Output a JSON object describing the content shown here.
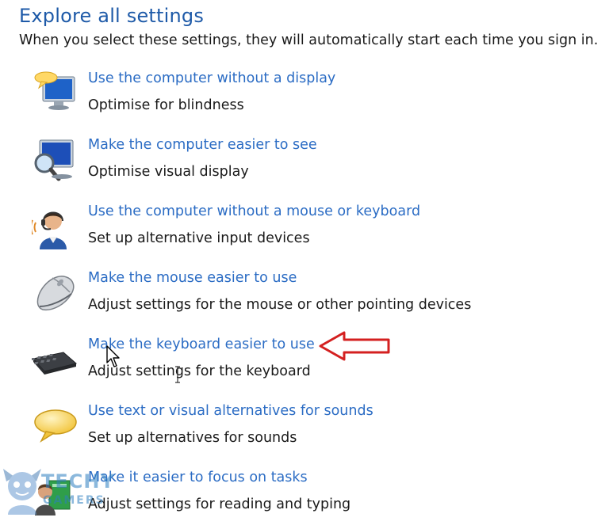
{
  "header": {
    "title": "Explore all settings",
    "subtitle": "When you select these settings, they will automatically start each time you sign in."
  },
  "items": [
    {
      "link": "Use the computer without a display",
      "desc": "Optimise for blindness",
      "icon": "monitor-speech-icon"
    },
    {
      "link": "Make the computer easier to see",
      "desc": "Optimise visual display",
      "icon": "magnifier-monitor-icon"
    },
    {
      "link": "Use the computer without a mouse or keyboard",
      "desc": "Set up alternative input devices",
      "icon": "person-headset-icon"
    },
    {
      "link": "Make the mouse easier to use",
      "desc": "Adjust settings for the mouse or other pointing devices",
      "icon": "mouse-icon"
    },
    {
      "link": "Make the keyboard easier to use",
      "desc": "Adjust settings for the keyboard",
      "icon": "keyboard-icon"
    },
    {
      "link": "Use text or visual alternatives for sounds",
      "desc": "Set up alternatives for sounds",
      "icon": "speech-bubble-icon"
    },
    {
      "link": "Make it easier to focus on tasks",
      "desc": "Adjust settings for reading and typing",
      "icon": "focus-tasks-icon"
    }
  ],
  "watermark": {
    "line1": "TECHY",
    "line2": "GAMERS"
  },
  "colors": {
    "heading": "#1e5aa8",
    "link": "#2b6cc4",
    "text": "#1a1a1a",
    "annotation_arrow": "#d42020"
  }
}
